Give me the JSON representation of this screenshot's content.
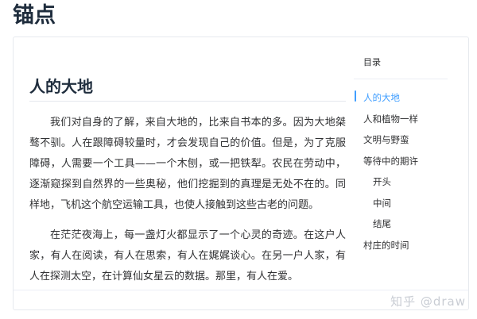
{
  "page": {
    "title": "锚点"
  },
  "content": {
    "heading": "人的大地",
    "paragraphs": [
      "我们对自身的了解，来自大地的，比来自书本的多。因为大地桀骜不驯。人在跟障碍较量时，才会发现自己的价值。但是，为了克服障碍，人需要一个工具——一个木刨，或一把铁犁。农民在劳动中，逐渐窥探到自然界的一些奥秘，他们挖掘到的真理是无处不在的。同样地，飞机这个航空运输工具，也使人接触到这些古老的问题。",
      "在茫茫夜海上，每一盏灯火都显示了一个心灵的奇迹。在这户人家，有人在阅读，有人在思索，有人在娓娓谈心。在另一户人家，有人在探测太空，在计算仙女星云的数据。那里，有人在爱。"
    ]
  },
  "toc": {
    "title": "目录",
    "items": [
      {
        "label": "人的大地",
        "active": true,
        "sub": false
      },
      {
        "label": "人和植物一样",
        "active": false,
        "sub": false
      },
      {
        "label": "文明与野蛮",
        "active": false,
        "sub": false
      },
      {
        "label": "等待中的期许",
        "active": false,
        "sub": false
      },
      {
        "label": "开头",
        "active": false,
        "sub": true
      },
      {
        "label": "中间",
        "active": false,
        "sub": true
      },
      {
        "label": "结尾",
        "active": false,
        "sub": true
      },
      {
        "label": "村庄的时间",
        "active": false,
        "sub": false
      }
    ]
  },
  "watermark": "知乎 @draw",
  "colors": {
    "accent": "#409eff",
    "text": "#303133",
    "heading": "#1f2d3d",
    "border": "#e6e9ee"
  }
}
